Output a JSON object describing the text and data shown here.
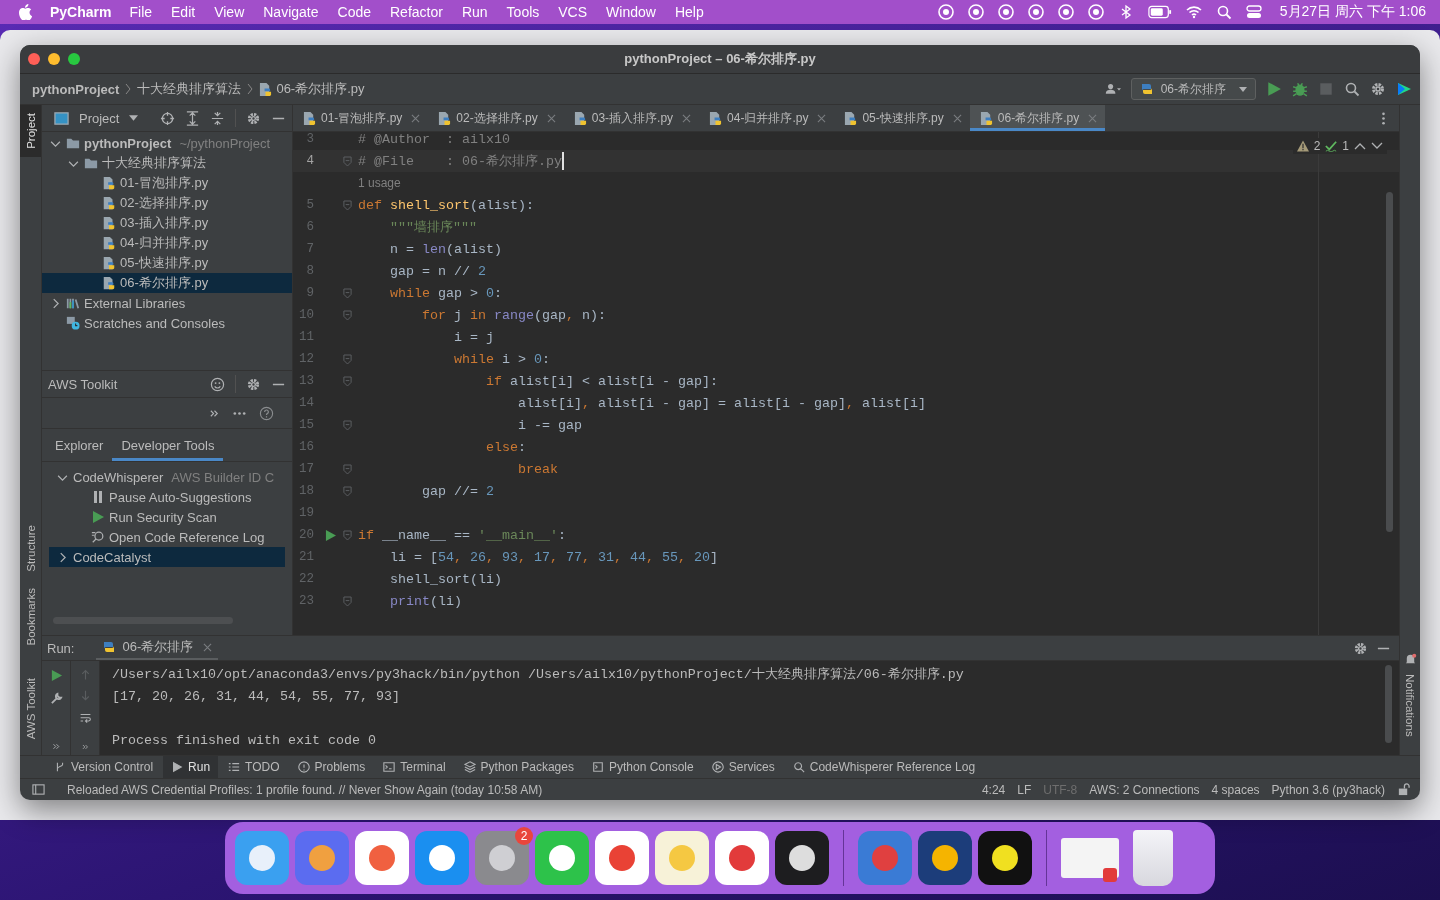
{
  "menubar": {
    "app": "PyCharm",
    "menus": [
      "File",
      "Edit",
      "View",
      "Navigate",
      "Code",
      "Refactor",
      "Run",
      "Tools",
      "VCS",
      "Window",
      "Help"
    ],
    "clock": "5月27日 周六 下午 1:06"
  },
  "window": {
    "title": "pythonProject – 06-希尔排序.py"
  },
  "breadcrumb": [
    "pythonProject",
    "十大经典排序算法",
    "06-希尔排序.py"
  ],
  "run_config": "06-希尔排序",
  "left_strip": [
    {
      "label": "Project",
      "selected": true
    },
    {
      "label": "Structure",
      "selected": false
    },
    {
      "label": "Bookmarks",
      "selected": false
    },
    {
      "label": "AWS Toolkit",
      "selected": false
    }
  ],
  "right_strip": [
    {
      "label": "Notifications",
      "selected": false
    }
  ],
  "project_panel": {
    "title": "Project",
    "tree": [
      {
        "label": "pythonProject",
        "hint": "~/pythonProject",
        "kind": "folder",
        "expanded": true,
        "selected": false,
        "children": [
          {
            "label": "十大经典排序算法",
            "kind": "folder",
            "expanded": true,
            "selected": false,
            "children": [
              {
                "label": "01-冒泡排序.py",
                "kind": "file",
                "selected": false
              },
              {
                "label": "02-选择排序.py",
                "kind": "file",
                "selected": false
              },
              {
                "label": "03-插入排序.py",
                "kind": "file",
                "selected": false
              },
              {
                "label": "04-归并排序.py",
                "kind": "file",
                "selected": false
              },
              {
                "label": "05-快速排序.py",
                "kind": "file",
                "selected": false
              },
              {
                "label": "06-希尔排序.py",
                "kind": "file",
                "selected": true
              }
            ]
          }
        ]
      },
      {
        "label": "External Libraries",
        "kind": "library",
        "expanded": false,
        "selected": false
      },
      {
        "label": "Scratches and Consoles",
        "kind": "scratch",
        "selected": false
      }
    ]
  },
  "aws_panel": {
    "title": "AWS Toolkit",
    "tabs": [
      {
        "label": "Explorer",
        "selected": false
      },
      {
        "label": "Developer Tools",
        "selected": true
      }
    ],
    "tree": [
      {
        "label": "CodeWhisperer",
        "hint": "AWS Builder ID C",
        "kind": "group",
        "expanded": true,
        "selected": false,
        "children": [
          {
            "label": "Pause Auto-Suggestions",
            "kind": "pause",
            "selected": false
          },
          {
            "label": "Run Security Scan",
            "kind": "run",
            "selected": false
          },
          {
            "label": "Open Code Reference Log",
            "kind": "log",
            "selected": false
          }
        ]
      },
      {
        "label": "CodeCatalyst",
        "kind": "group",
        "expanded": false,
        "selected": true
      }
    ]
  },
  "editor_tabs": [
    {
      "label": "01-冒泡排序.py",
      "selected": false
    },
    {
      "label": "02-选择排序.py",
      "selected": false
    },
    {
      "label": "03-插入排序.py",
      "selected": false
    },
    {
      "label": "04-归并排序.py",
      "selected": false
    },
    {
      "label": "05-快速排序.py",
      "selected": false
    },
    {
      "label": "06-希尔排序.py",
      "selected": true
    }
  ],
  "inspections": {
    "warnings": "2",
    "typos": "1"
  },
  "code": [
    {
      "num": "3",
      "tokens": [
        {
          "kind": "cmt",
          "text": "# @Author  : ailx10"
        }
      ]
    },
    {
      "num": "4",
      "fold": true,
      "current": true,
      "tokens": [
        {
          "kind": "cmt",
          "text": "# @File    : 06-希尔排序.py"
        }
      ]
    },
    {
      "kind": "hint",
      "text": "1 usage"
    },
    {
      "num": "5",
      "fold": true,
      "tokens": [
        {
          "kind": "kw",
          "text": "def "
        },
        {
          "kind": "fn",
          "text": "shell_sort"
        },
        {
          "kind": "p",
          "text": "(alist):"
        }
      ]
    },
    {
      "num": "6",
      "tokens": [
        {
          "kind": "str",
          "text": "    \"\"\"墙排序\"\"\""
        }
      ]
    },
    {
      "num": "7",
      "tokens": [
        {
          "kind": "p",
          "text": "    n = "
        },
        {
          "kind": "bi",
          "text": "len"
        },
        {
          "kind": "p",
          "text": "(alist)"
        }
      ]
    },
    {
      "num": "8",
      "tokens": [
        {
          "kind": "p",
          "text": "    gap = n // "
        },
        {
          "kind": "num",
          "text": "2"
        }
      ]
    },
    {
      "num": "9",
      "fold": true,
      "tokens": [
        {
          "kind": "kw",
          "text": "    while"
        },
        {
          "kind": "p",
          "text": " gap > "
        },
        {
          "kind": "num",
          "text": "0"
        },
        {
          "kind": "p",
          "text": ":"
        }
      ]
    },
    {
      "num": "10",
      "fold": true,
      "tokens": [
        {
          "kind": "kw",
          "text": "        for"
        },
        {
          "kind": "p",
          "text": " j "
        },
        {
          "kind": "kw",
          "text": "in"
        },
        {
          "kind": "bi",
          "text": " range"
        },
        {
          "kind": "p",
          "text": "(gap"
        },
        {
          "kind": "kw",
          "text": ","
        },
        {
          "kind": "p",
          "text": " n):"
        }
      ]
    },
    {
      "num": "11",
      "tokens": [
        {
          "kind": "p",
          "text": "            i = j"
        }
      ]
    },
    {
      "num": "12",
      "fold": true,
      "tokens": [
        {
          "kind": "kw",
          "text": "            while"
        },
        {
          "kind": "p",
          "text": " i > "
        },
        {
          "kind": "num",
          "text": "0"
        },
        {
          "kind": "p",
          "text": ":"
        }
      ]
    },
    {
      "num": "13",
      "fold": true,
      "tokens": [
        {
          "kind": "kw",
          "text": "                if"
        },
        {
          "kind": "p",
          "text": " alist[i] < alist[i - gap]:"
        }
      ]
    },
    {
      "num": "14",
      "tokens": [
        {
          "kind": "p",
          "text": "                    alist[i]"
        },
        {
          "kind": "kw",
          "text": ","
        },
        {
          "kind": "p",
          "text": " alist[i - gap] = alist[i - gap]"
        },
        {
          "kind": "kw",
          "text": ","
        },
        {
          "kind": "p",
          "text": " alist[i]"
        }
      ]
    },
    {
      "num": "15",
      "fold": true,
      "tokens": [
        {
          "kind": "p",
          "text": "                    i -= gap"
        }
      ]
    },
    {
      "num": "16",
      "tokens": [
        {
          "kind": "kw",
          "text": "                else"
        },
        {
          "kind": "p",
          "text": ":"
        }
      ]
    },
    {
      "num": "17",
      "fold": true,
      "tokens": [
        {
          "kind": "kw",
          "text": "                    break"
        }
      ]
    },
    {
      "num": "18",
      "fold": true,
      "tokens": [
        {
          "kind": "p",
          "text": "        gap //= "
        },
        {
          "kind": "num",
          "text": "2"
        }
      ]
    },
    {
      "num": "19"
    },
    {
      "num": "20",
      "fold": true,
      "runnable": true,
      "tokens": [
        {
          "kind": "kw",
          "text": "if"
        },
        {
          "kind": "p",
          "text": " __name__ == "
        },
        {
          "kind": "str",
          "text": "'__main__'"
        },
        {
          "kind": "p",
          "text": ":"
        }
      ]
    },
    {
      "num": "21",
      "tokens": [
        {
          "kind": "p",
          "text": "    li = ["
        },
        {
          "kind": "num",
          "text": "54"
        },
        {
          "kind": "kw",
          "text": ","
        },
        {
          "kind": "num",
          "text": " 26"
        },
        {
          "kind": "kw",
          "text": ","
        },
        {
          "kind": "num",
          "text": " 93"
        },
        {
          "kind": "kw",
          "text": ","
        },
        {
          "kind": "num",
          "text": " 17"
        },
        {
          "kind": "kw",
          "text": ","
        },
        {
          "kind": "num",
          "text": " 77"
        },
        {
          "kind": "kw",
          "text": ","
        },
        {
          "kind": "num",
          "text": " 31"
        },
        {
          "kind": "kw",
          "text": ","
        },
        {
          "kind": "num",
          "text": " 44"
        },
        {
          "kind": "kw",
          "text": ","
        },
        {
          "kind": "num",
          "text": " 55"
        },
        {
          "kind": "kw",
          "text": ","
        },
        {
          "kind": "num",
          "text": " 20"
        },
        {
          "kind": "p",
          "text": "]"
        }
      ]
    },
    {
      "num": "22",
      "tokens": [
        {
          "kind": "p",
          "text": "    shell_sort(li)"
        }
      ]
    },
    {
      "num": "23",
      "fold": true,
      "tokens": [
        {
          "kind": "bi",
          "text": "    print"
        },
        {
          "kind": "p",
          "text": "(li)"
        }
      ]
    }
  ],
  "run_panel": {
    "label": "Run:",
    "tab": "06-希尔排序",
    "output": [
      {
        "text": "/Users/ailx10/opt/anaconda3/envs/py3hack/bin/python /Users/ailx10/pythonProject/十大经典排序算法/06-希尔排序.py",
        "kind": "command"
      },
      {
        "text": "[17, 20, 26, 31, 44, 54, 55, 77, 93]",
        "kind": "stdout"
      },
      {
        "text": "Process finished with exit code 0",
        "kind": "status"
      }
    ]
  },
  "tool_tabs": [
    {
      "label": "Version Control",
      "kind": "vcs",
      "selected": false
    },
    {
      "label": "Run",
      "kind": "run",
      "selected": true
    },
    {
      "label": "TODO",
      "kind": "todo",
      "selected": false
    },
    {
      "label": "Problems",
      "kind": "problems",
      "selected": false
    },
    {
      "label": "Terminal",
      "kind": "terminal",
      "selected": false
    },
    {
      "label": "Python Packages",
      "kind": "packages",
      "selected": false
    },
    {
      "label": "Python Console",
      "kind": "console",
      "selected": false
    },
    {
      "label": "Services",
      "kind": "services",
      "selected": false
    },
    {
      "label": "CodeWhisperer Reference Log",
      "kind": "reference",
      "selected": false
    }
  ],
  "status_bar": {
    "message": "Reloaded AWS Credential Profiles: 1 profile found. // Never Show Again (today 10:58 AM)",
    "items": [
      {
        "text": "4:24",
        "disabled": false
      },
      {
        "text": "LF",
        "disabled": false
      },
      {
        "text": "UTF-8",
        "disabled": true
      },
      {
        "text": "AWS: 2 Connections",
        "disabled": false
      },
      {
        "text": "4 spaces",
        "disabled": false
      },
      {
        "text": "Python 3.6 (py3hack)",
        "disabled": false
      }
    ]
  },
  "dock": {
    "badge": "2"
  }
}
